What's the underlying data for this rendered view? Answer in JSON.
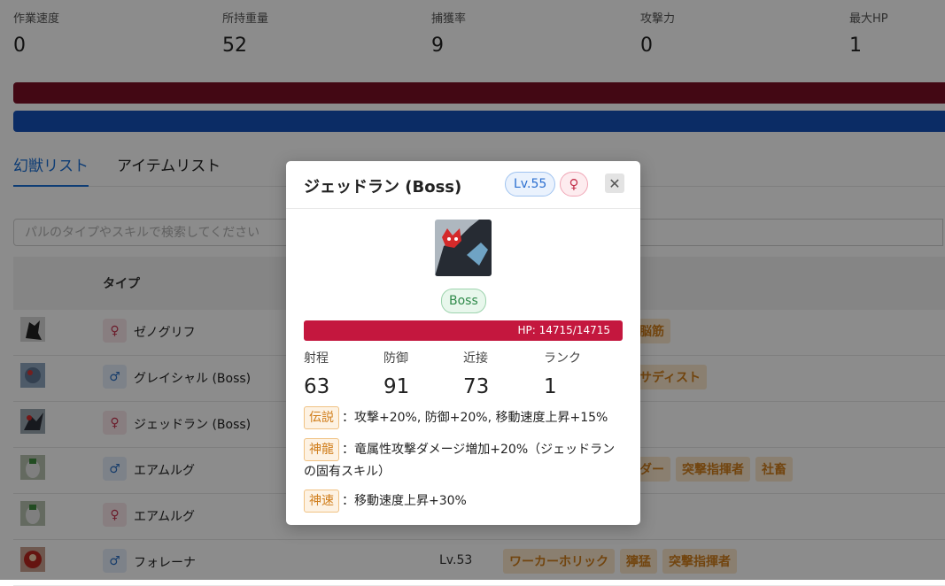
{
  "stats": [
    {
      "label": "作業速度",
      "value": "0"
    },
    {
      "label": "所持重量",
      "value": "52"
    },
    {
      "label": "捕獲率",
      "value": "9"
    },
    {
      "label": "攻撃力",
      "value": "0"
    },
    {
      "label": "最大HP",
      "value": "1"
    }
  ],
  "tabs": [
    {
      "label": "幻獣リスト",
      "active": true
    },
    {
      "label": "アイテムリスト",
      "active": false
    }
  ],
  "search": {
    "placeholder": "パルのタイプやスキルで検索してください"
  },
  "table": {
    "header_type": "タイプ",
    "rows": [
      {
        "gender": "♀",
        "gender_kind": "f",
        "name": "ゼノグリフ",
        "level": "",
        "tags": [
          "脳筋"
        ]
      },
      {
        "gender": "♂",
        "gender_kind": "m",
        "name": "グレイシャル (Boss)",
        "level": "",
        "tags": [
          "サディスト"
        ]
      },
      {
        "gender": "♀",
        "gender_kind": "f",
        "name": "ジェッドラン (Boss)",
        "level": "",
        "tags": []
      },
      {
        "gender": "♂",
        "gender_kind": "m",
        "name": "エアムルグ",
        "level": "",
        "tags": [
          "ダー",
          "突撃指揮者",
          "社畜"
        ]
      },
      {
        "gender": "♀",
        "gender_kind": "f",
        "name": "エアムルグ",
        "level": "",
        "tags": []
      },
      {
        "gender": "♂",
        "gender_kind": "m",
        "name": "フォレーナ",
        "level": "Lv.53",
        "tags": [
          "ワーカーホリック",
          "獰猛",
          "突撃指揮者"
        ]
      }
    ]
  },
  "modal": {
    "title": "ジェッドラン (Boss)",
    "level": "Lv.55",
    "sex": "♀",
    "close_icon": "✕",
    "boss_label": "Boss",
    "hp_text": "HP: 14715/14715",
    "stats": [
      {
        "label": "射程",
        "value": "63"
      },
      {
        "label": "防御",
        "value": "91"
      },
      {
        "label": "近接",
        "value": "73"
      },
      {
        "label": "ランク",
        "value": "1"
      }
    ],
    "skills": [
      {
        "name": "伝説",
        "desc": "：攻撃+20%, 防御+20%, 移動速度上昇+15%"
      },
      {
        "name": "神龍",
        "desc": "：竜属性攻撃ダメージ増加+20%（ジェッドランの固有スキル）"
      },
      {
        "name": "神速",
        "desc": "：移動速度上昇+30%"
      }
    ]
  },
  "colors": {
    "primary": "#1b6fd6",
    "hp_bar": "#c4173e",
    "bar_red": "#7b0f25",
    "bar_blue": "#1450b8",
    "tag_text": "#d07e1c"
  }
}
